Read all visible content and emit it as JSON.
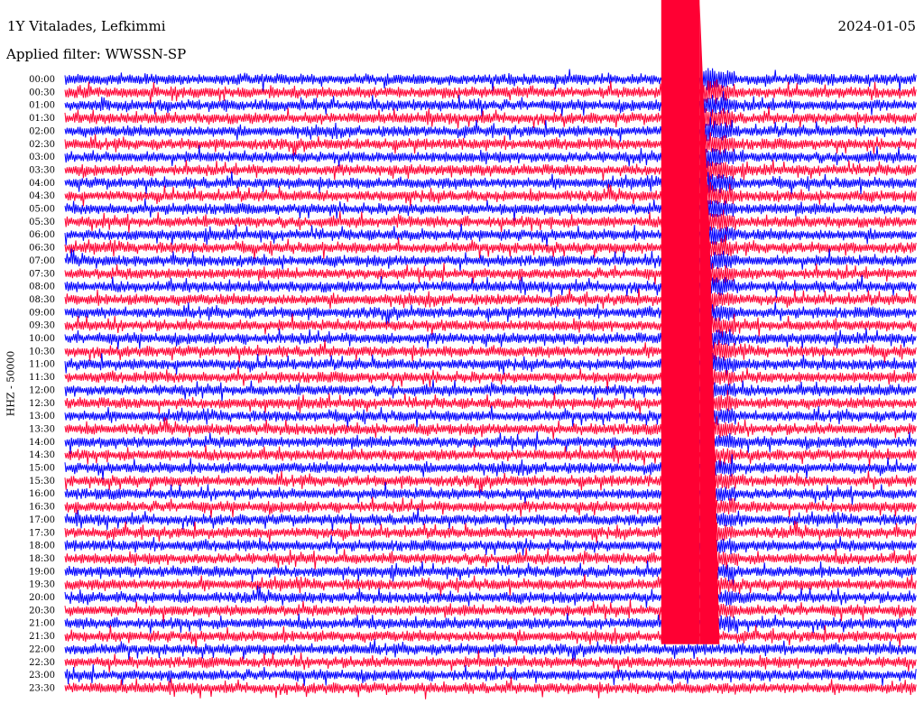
{
  "header": {
    "station": "1Y Vitalades, Lefkimmi",
    "date": "2024-01-05",
    "filter": "Applied filter: WWSSN-SP"
  },
  "chart_data": {
    "type": "line",
    "title": "1Y Vitalades, Lefkimmi",
    "ylabel": "HHZ - 50000",
    "xlabel": "",
    "trace_count": 48,
    "colors": [
      "#0000ff",
      "#ff0033"
    ],
    "row_labels": [
      "00:00",
      "00:30",
      "01:00",
      "01:30",
      "02:00",
      "02:30",
      "03:00",
      "03:30",
      "04:00",
      "04:30",
      "05:00",
      "05:30",
      "06:00",
      "06:30",
      "07:00",
      "07:30",
      "08:00",
      "08:30",
      "09:00",
      "09:30",
      "10:00",
      "10:30",
      "11:00",
      "11:30",
      "12:00",
      "12:30",
      "13:00",
      "13:30",
      "14:00",
      "14:30",
      "15:00",
      "15:30",
      "16:00",
      "16:30",
      "17:00",
      "17:30",
      "18:00",
      "18:30",
      "19:00",
      "19:30",
      "20:00",
      "20:30",
      "21:00",
      "21:30",
      "22:00",
      "22:30",
      "23:00",
      "23:30"
    ],
    "saturated_window_fraction": [
      0.7,
      0.745
    ],
    "coda_decay_until_row": 43
  }
}
